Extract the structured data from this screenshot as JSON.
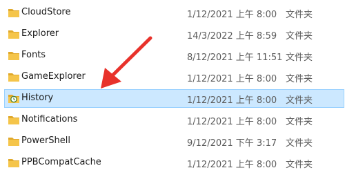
{
  "files": [
    {
      "name": "CloudStore",
      "date": "1/12/2021 上午 8:00",
      "type": "文件夹",
      "icon": "folder-icon",
      "selected": false
    },
    {
      "name": "Explorer",
      "date": "14/3/2022 上午 8:59",
      "type": "文件夹",
      "icon": "folder-icon",
      "selected": false
    },
    {
      "name": "Fonts",
      "date": "8/12/2021 上午 11:51",
      "type": "文件夹",
      "icon": "folder-icon",
      "selected": false
    },
    {
      "name": "GameExplorer",
      "date": "1/12/2021 上午 8:00",
      "type": "文件夹",
      "icon": "folder-icon",
      "selected": false
    },
    {
      "name": "History",
      "date": "1/12/2021 上午 8:00",
      "type": "文件夹",
      "icon": "history-folder-icon",
      "selected": true
    },
    {
      "name": "Notifications",
      "date": "1/12/2021 上午 8:00",
      "type": "文件夹",
      "icon": "folder-icon",
      "selected": false
    },
    {
      "name": "PowerShell",
      "date": "9/12/2021 下午 3:17",
      "type": "文件夹",
      "icon": "folder-icon",
      "selected": false
    },
    {
      "name": "PPBCompatCache",
      "date": "1/12/2021 上午 8:00",
      "type": "文件夹",
      "icon": "folder-icon",
      "selected": false
    }
  ],
  "colors": {
    "folder": "#f5c54a",
    "folder_dark": "#e0a92c",
    "selection_bg": "#cce8ff",
    "selection_border": "#99d1ff",
    "arrow": "#e8322b"
  },
  "annotation": {
    "type": "red-arrow",
    "points_to": "History"
  }
}
